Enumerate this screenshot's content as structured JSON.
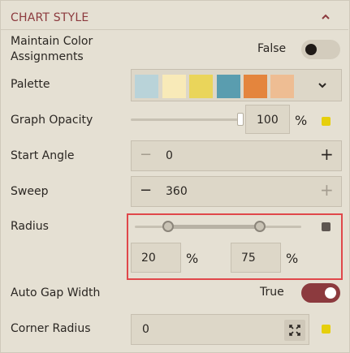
{
  "section": {
    "title": "CHART STYLE"
  },
  "maintain_colors": {
    "label": "Maintain Color Assignments",
    "label_line1": "Maintain Color",
    "label_line2": "Assignments",
    "state_text": "False",
    "checked": false
  },
  "palette": {
    "label": "Palette",
    "swatches": [
      "#b9d3d9",
      "#f8eab8",
      "#ead55a",
      "#5a9daf",
      "#e4853d",
      "#eebd93"
    ]
  },
  "graph_opacity": {
    "label": "Graph Opacity",
    "value": "100",
    "unit": "%",
    "slider_fraction": 1.0
  },
  "start_angle": {
    "label": "Start Angle",
    "value": "0",
    "minus": "−",
    "plus": "+"
  },
  "sweep": {
    "label": "Sweep",
    "value": "360",
    "minus": "−",
    "plus": "+"
  },
  "radius": {
    "label": "Radius",
    "inner": "20",
    "outer": "75",
    "unit": "%",
    "inner_fraction": 0.2,
    "outer_fraction": 0.75
  },
  "auto_gap": {
    "label": "Auto Gap Width",
    "state_text": "True",
    "checked": true
  },
  "corner_radius": {
    "label": "Corner Radius",
    "value": "0"
  },
  "colors": {
    "accent": "#8c3a3e",
    "indicator_yellow": "#e6cf0c",
    "highlight": "#e0474a"
  }
}
